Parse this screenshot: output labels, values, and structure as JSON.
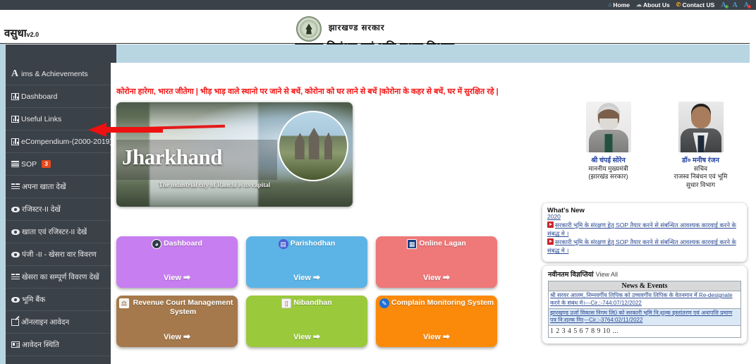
{
  "topbar": {
    "links": [
      {
        "label": "Home",
        "icon": "home-icon"
      },
      {
        "label": "About Us",
        "icon": "about-icon"
      },
      {
        "label": "Contact US",
        "icon": "phone-icon"
      }
    ],
    "font_controls": [
      {
        "label": "A",
        "name": "font-increase",
        "dot": "+"
      },
      {
        "label": "A",
        "name": "font-normal",
        "dot": ""
      },
      {
        "label": "A",
        "name": "font-decrease",
        "dot": "-"
      }
    ]
  },
  "header": {
    "brand_name": "वसुधा",
    "brand_version": "v2.0",
    "government": "झारखण्ड सरकार",
    "department": "राजस्व,निबंधन एवं भूमि सुधार विभाग",
    "emblem": "jharkhand-government-emblem"
  },
  "sidebar": {
    "items": [
      {
        "label": "ims & Achievements",
        "prefix": "A",
        "icon": "letter-a-icon"
      },
      {
        "label": "Dashboard",
        "icon": "bar-chart-icon"
      },
      {
        "label": "Useful Links",
        "icon": "bar-chart-icon"
      },
      {
        "label": "eCompendium-(2000-2019)",
        "icon": "bar-chart-icon"
      },
      {
        "label": "SOP",
        "icon": "lines-icon",
        "badge": "3"
      },
      {
        "label": "अपना खाता देखें",
        "icon": "half-lines-icon"
      },
      {
        "label": "रजिस्टर-II देखें",
        "icon": "eye-icon"
      },
      {
        "label": "खाता एवं रजिस्टर-II देखें",
        "icon": "eye-icon"
      },
      {
        "label": "पंजी -II - खेसरा वार विवरण",
        "icon": "eye-icon"
      },
      {
        "label": "खेसरा का सम्पूर्ण विवरण देखें",
        "icon": "half-lines-icon"
      },
      {
        "label": "भूमि बैंक",
        "icon": "eye-icon"
      },
      {
        "label": "ऑनलाइन आवेदन",
        "icon": "pen-edit-icon"
      },
      {
        "label": "आवेदन स्थिति",
        "icon": "box-list-icon"
      }
    ]
  },
  "main": {
    "marquee": "कोरोना हारेगा, भारत जीतेगा | भीड़ भाड़ वाले स्थानो पर जाने से बचें, कोरोना को घर लाने से बचें |कोरोना के कहर से बचें, घर में सुरक्षित रहे |",
    "banner": {
      "title": "Jharkhand",
      "subtitle": "The industrial city of Ranchi is its capital",
      "image": "jharkhand-waterfall-temple-banner"
    },
    "officials": [
      {
        "name": "श्री चंपई सोरेन",
        "role_line1": "माननीय मुख्यमंत्री",
        "role_line2": "(झारखंड सरकार)",
        "photo": "chief-minister-photo"
      },
      {
        "name": "डॉ० मनीष रंजन",
        "role_line1": "सचिव",
        "role_line2": "राजस्व निबंधन एवं भूमि",
        "role_line3": "सुधार विभाग",
        "photo": "secretary-photo"
      }
    ],
    "tiles": [
      {
        "label": "Dashboard",
        "view": "View",
        "color": "#c77ef0",
        "icon": "dashboard-gauge-icon",
        "icon_class": "ti-dash",
        "glyph": "◕"
      },
      {
        "label": "Parishodhan",
        "view": "View",
        "color": "#5cb4e6",
        "icon": "parishodhan-doc-icon",
        "icon_class": "ti-pari",
        "glyph": "▤"
      },
      {
        "label": "Online Lagan",
        "view": "View",
        "color": "#ef7878",
        "icon": "online-lagan-bank-icon",
        "icon_class": "ti-lagan",
        "glyph": "▦"
      },
      {
        "label": "Revenue Court Management System",
        "view": "View",
        "color": "#a5794b",
        "icon": "gavel-icon",
        "icon_class": "ti-court",
        "glyph": "⚖"
      },
      {
        "label": "Nibandhan",
        "view": "View",
        "color": "#9ac93b",
        "icon": "book-icon",
        "icon_class": "ti-nib",
        "glyph": "▯"
      },
      {
        "label": "Complain Monitoring System",
        "view": "View",
        "color": "#fb8a0b",
        "icon": "complaint-chat-icon",
        "icon_class": "ti-comp",
        "glyph": "✎"
      }
    ],
    "whats_new": {
      "title": "What's New",
      "year": "2020",
      "items": [
        "सरकारी भूमि के संरक्षण हेतु SOP तैयार करने से संबन्धित आवश्यक कारवाई करने के संबद्ध मे ।",
        "सरकारी भूमि के संरक्षण हेतु SOP तैयार करने से संबन्धित आवश्यक कारवाई करने के संबद्ध मे ।"
      ]
    },
    "news_events": {
      "heading_hi": "नवीनतम विज्ञप्तियां",
      "view_all": "View All",
      "table_header": "News & Events",
      "rows": [
        "श्री सरवर आलम, निम्नवर्गीय लिपिक को उच्चवर्गीय लिपिक के वेतनमान में Re-designate करने के संबंध में।---Cir.:-744:07/12/2022",
        "झारखण्ड उर्जा विकास निगम लि0 को सरकारी भूमि नि:शुल्क हस्तांतरण एवं अनापत्ति प्रमाण पत्र नि:शुल्क निर्---Cir.:-3764:02/11/2022"
      ],
      "pagination": "1 2 3 4 5 6 7 8 9 10 ..."
    }
  },
  "annotation": {
    "arrow_color": "#ee1111",
    "points_to": "Useful Links"
  }
}
